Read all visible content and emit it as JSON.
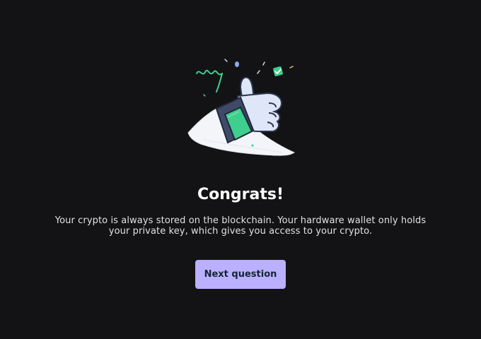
{
  "congrats": {
    "title": "Congrats!",
    "description": "Your crypto is always stored on the blockchain. Your hardware wallet only holds your private key, which gives you access to your crypto.",
    "next_button_label": "Next question"
  },
  "colors": {
    "background": "#131315",
    "accent_button": "#bbb0ff",
    "button_text": "#142533",
    "illustration_green": "#3ecf8e",
    "illustration_blue": "#8fa8e8"
  },
  "icons": [
    "thumbs-up-illustration",
    "confetti-icon",
    "check-badge-icon"
  ]
}
